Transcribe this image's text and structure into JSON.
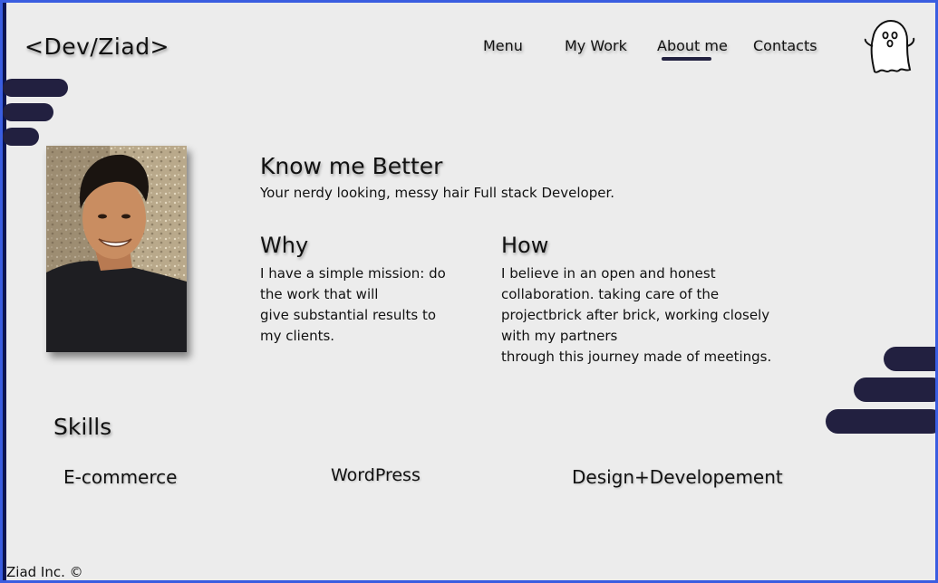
{
  "header": {
    "logo": "<Dev/Ziad>",
    "nav": [
      {
        "label": "Menu"
      },
      {
        "label": "My Work"
      },
      {
        "label": "About me"
      },
      {
        "label": "Contacts"
      }
    ],
    "active_nav": "About me",
    "ghost_icon": "ghost-icon"
  },
  "about": {
    "title": "Know me Better",
    "subtitle": "Your nerdy looking, messy hair Full stack Developer.",
    "why": {
      "heading": "Why",
      "lines": [
        "I have a simple mission: do",
        "the work that will",
        "give substantial results to",
        "my clients."
      ]
    },
    "how": {
      "heading": "How",
      "lines": [
        "I believe in an open and honest",
        "collaboration. taking care of the",
        "projectbrick after brick, working closely",
        "with my partners",
        "through this journey made of meetings."
      ]
    }
  },
  "skills": {
    "title": "Skills",
    "items": [
      "E-commerce",
      "WordPress",
      "Design+Developement"
    ]
  },
  "footer": {
    "text": "Ziad Inc. ©"
  },
  "colors": {
    "background": "#ececec",
    "accent_bars": "#222040",
    "border": "#3a5de0"
  }
}
